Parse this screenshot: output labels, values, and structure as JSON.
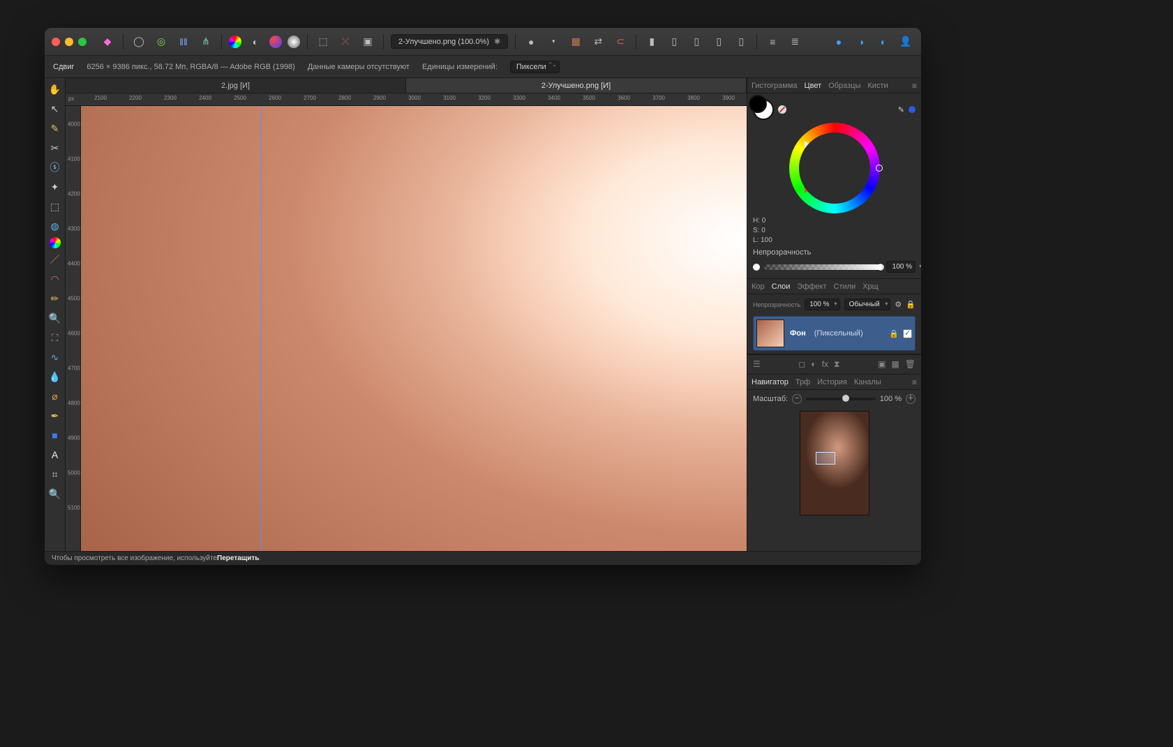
{
  "window": {
    "doc_title": "2-Улучшено.png (100.0%)",
    "modified": "✱"
  },
  "context": {
    "tool_label": "Сдвиг",
    "dims": "6256 × 9386 пикс., 58.72 Мп, RGBA/8 — Adobe RGB (1998)",
    "camera": "Данные камеры отсутствуют",
    "units_label": "Единицы измерений:",
    "units_value": "Пиксели"
  },
  "tabs": [
    {
      "label": "2.jpg [И]",
      "active": false
    },
    {
      "label": "2-Улучшено.png [И]",
      "active": true
    }
  ],
  "ruler": {
    "unit": "px",
    "h_ticks": [
      "2100",
      "2200",
      "2300",
      "2400",
      "2500",
      "2600",
      "2700",
      "2800",
      "2900",
      "3000",
      "3100",
      "3200",
      "3300",
      "3400",
      "3500",
      "3600",
      "3700",
      "3800",
      "3900"
    ],
    "v_ticks": [
      "4000",
      "4100",
      "4200",
      "4300",
      "4400",
      "4500",
      "4600",
      "4700",
      "4800",
      "4900",
      "5000",
      "5100"
    ]
  },
  "panels": {
    "color_tabs": [
      "Гистограмма",
      "Цвет",
      "Образцы",
      "Кисти"
    ],
    "color_active": "Цвет",
    "hsl": {
      "h": "H: 0",
      "s": "S: 0",
      "l": "L: 100"
    },
    "opacity_label": "Непрозрачность",
    "opacity_value": "100 %",
    "layer_tabs": [
      "Кор",
      "Слои",
      "Эффект",
      "Стили",
      "Хрщ"
    ],
    "layer_active": "Слои",
    "layer_opacity_label": "Непрозрачность",
    "layer_opacity_value": "100 %",
    "blend_mode": "Обычный",
    "layer_name": "Фон",
    "layer_type": "(Пиксельный)",
    "nav_tabs": [
      "Навигатор",
      "Трф",
      "История",
      "Каналы"
    ],
    "nav_active": "Навигатор",
    "zoom_label": "Масштаб:",
    "zoom_value": "100 %"
  },
  "status": {
    "prefix": "Чтобы просмотреть все изображение, используйте ",
    "bold": "Перетащить",
    "suffix": "."
  }
}
